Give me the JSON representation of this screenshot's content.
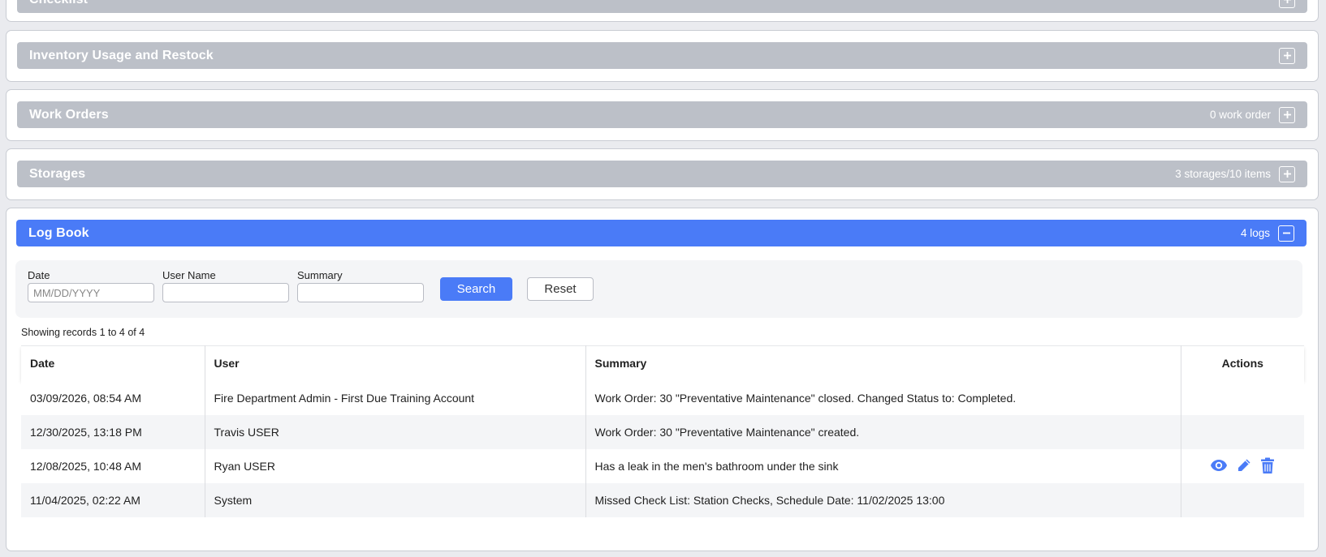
{
  "panels": {
    "checklist": {
      "title": "Checklist",
      "count": ""
    },
    "inventory": {
      "title": "Inventory Usage and Restock",
      "count": ""
    },
    "work_orders": {
      "title": "Work Orders",
      "count": "0 work order"
    },
    "storages": {
      "title": "Storages",
      "count": "3 storages/10 items"
    },
    "log_book": {
      "title": "Log Book",
      "count": "4 logs"
    }
  },
  "filters": {
    "date_label": "Date",
    "date_placeholder": "MM/DD/YYYY",
    "user_label": "User Name",
    "user_value": "",
    "summary_label": "Summary",
    "summary_value": "",
    "search_label": "Search",
    "reset_label": "Reset"
  },
  "records_info": "Showing records 1 to 4 of 4",
  "table": {
    "headers": [
      "Date",
      "User",
      "Summary",
      "Actions"
    ],
    "rows": [
      {
        "date": "03/09/2026, 08:54 AM",
        "user": "Fire Department Admin - First Due Training Account",
        "summary": "Work Order: 30 \"Preventative Maintenance\" closed. Changed Status to: Completed."
      },
      {
        "date": "12/30/2025, 13:18 PM",
        "user": "Travis USER",
        "summary": "Work Order: 30 \"Preventative Maintenance\" created."
      },
      {
        "date": "12/08/2025, 10:48 AM",
        "user": "Ryan USER",
        "summary": "Has a leak in the men's bathroom under the sink"
      },
      {
        "date": "11/04/2025, 02:22 AM",
        "user": "System",
        "summary": "Missed Check List: Station Checks, Schedule Date: 11/02/2025 13:00"
      }
    ]
  },
  "icons": {
    "view": "eye-icon",
    "edit": "pencil-icon",
    "delete": "trash-icon",
    "expand": "plus-icon",
    "collapse": "minus-icon"
  },
  "colors": {
    "accent": "#4a7bf7",
    "collapsed_header": "#bcc0c8"
  }
}
